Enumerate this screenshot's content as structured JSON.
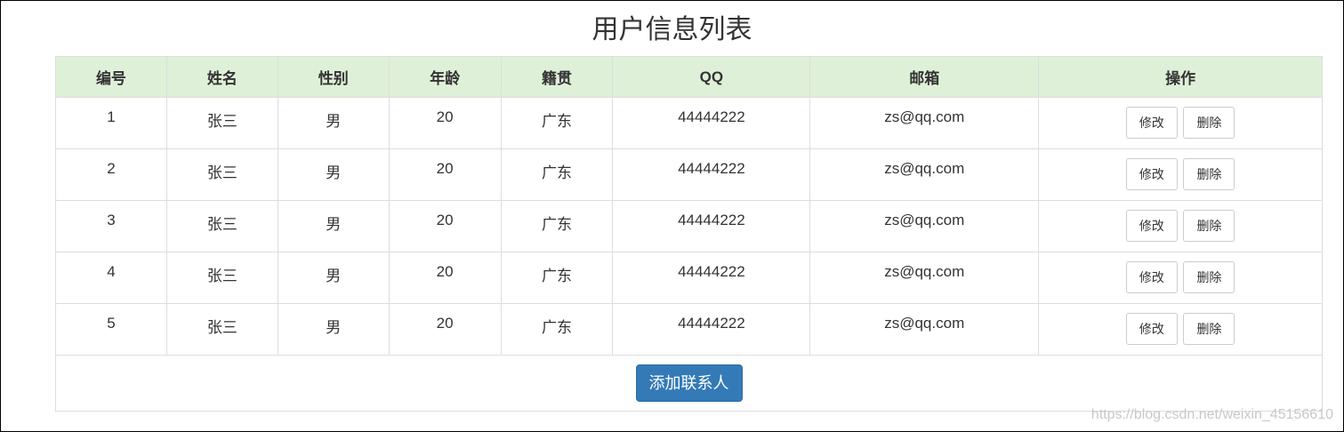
{
  "page": {
    "title": "用户信息列表",
    "watermark": "https://blog.csdn.net/weixin_45156610"
  },
  "table": {
    "headers": [
      "编号",
      "姓名",
      "性别",
      "年龄",
      "籍贯",
      "QQ",
      "邮箱",
      "操作"
    ],
    "rows": [
      {
        "id": "1",
        "name": "张三",
        "gender": "男",
        "age": "20",
        "origin": "广东",
        "qq": "44444222",
        "email": "zs@qq.com"
      },
      {
        "id": "2",
        "name": "张三",
        "gender": "男",
        "age": "20",
        "origin": "广东",
        "qq": "44444222",
        "email": "zs@qq.com"
      },
      {
        "id": "3",
        "name": "张三",
        "gender": "男",
        "age": "20",
        "origin": "广东",
        "qq": "44444222",
        "email": "zs@qq.com"
      },
      {
        "id": "4",
        "name": "张三",
        "gender": "男",
        "age": "20",
        "origin": "广东",
        "qq": "44444222",
        "email": "zs@qq.com"
      },
      {
        "id": "5",
        "name": "张三",
        "gender": "男",
        "age": "20",
        "origin": "广东",
        "qq": "44444222",
        "email": "zs@qq.com"
      }
    ],
    "edit_label": "修改",
    "delete_label": "删除",
    "add_contact_label": "添加联系人"
  },
  "colors": {
    "header_bg": "#dff0d8",
    "primary": "#337ab7",
    "border": "#dddddd"
  }
}
